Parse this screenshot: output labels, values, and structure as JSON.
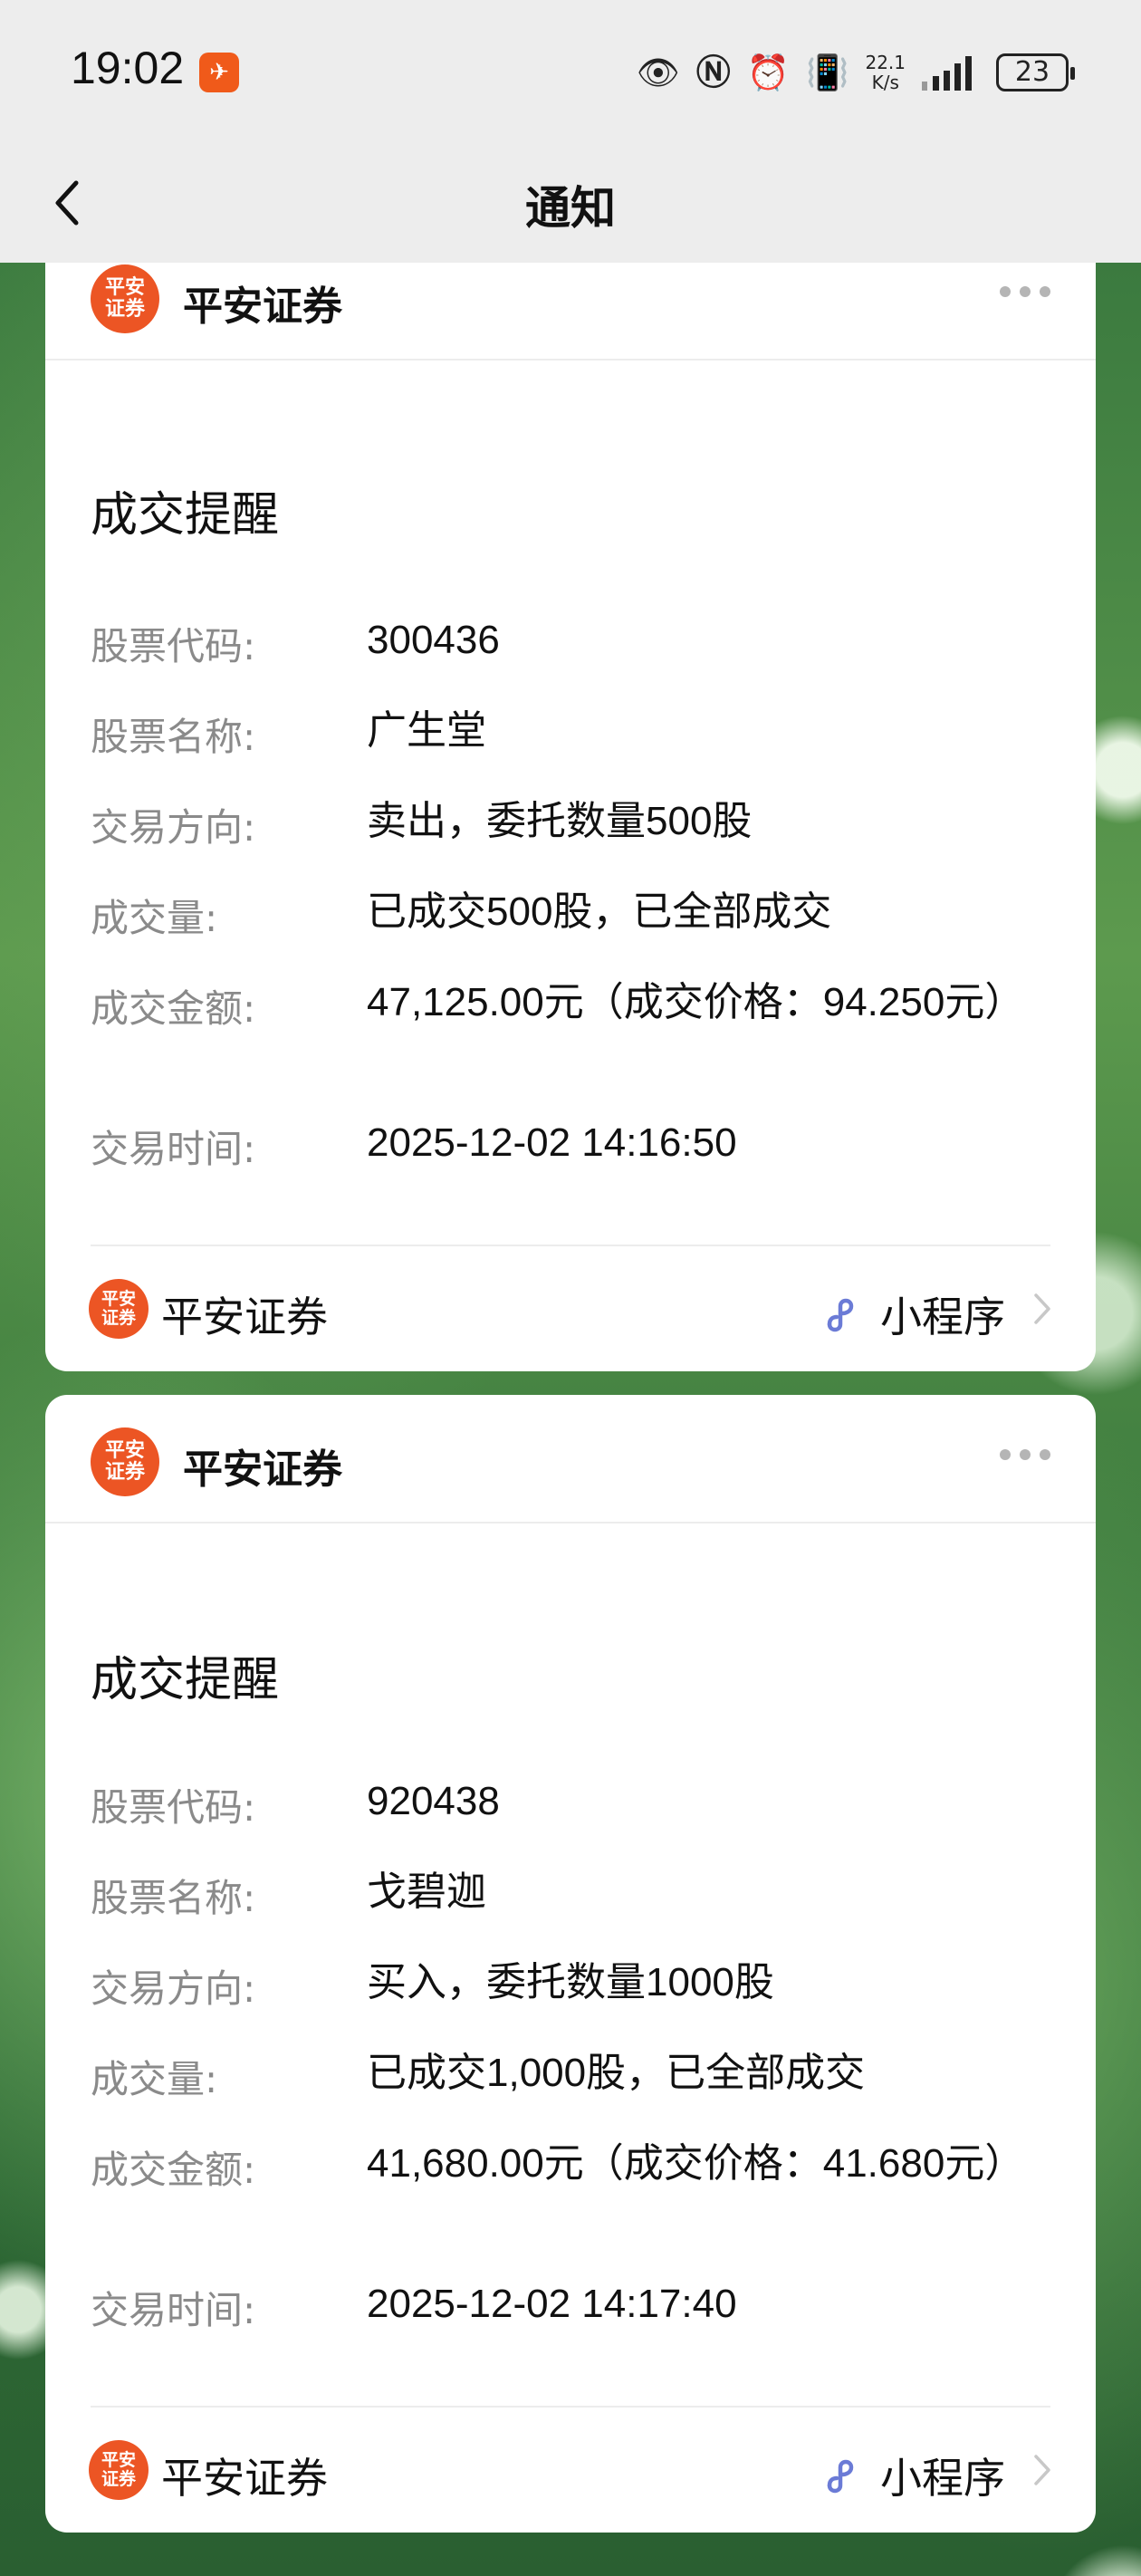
{
  "status_bar": {
    "time": "19:02",
    "app_badge_icon": "feishu-icon",
    "net_speed_value": "22.1",
    "net_speed_unit": "K/s",
    "battery": "23"
  },
  "nav": {
    "title": "通知"
  },
  "cards": [
    {
      "source": "平安证券",
      "logo_text_1": "平安",
      "logo_text_2": "证券",
      "title": "成交提醒",
      "rows": [
        {
          "label": "股票代码:",
          "value": "300436"
        },
        {
          "label": "股票名称:",
          "value": "广生堂"
        },
        {
          "label": "交易方向:",
          "value": "卖出，委托数量500股"
        },
        {
          "label": "成交量:",
          "value": "已成交500股，已全部成交"
        },
        {
          "label": "成交金额:",
          "value": "47,125.00元（成交价格：94.250元）"
        },
        {
          "label": "交易时间:",
          "value": "2025-12-02 14:16:50"
        }
      ],
      "footer_source": "平安证券",
      "mini_program_label": "小程序"
    },
    {
      "source": "平安证券",
      "logo_text_1": "平安",
      "logo_text_2": "证券",
      "title": "成交提醒",
      "rows": [
        {
          "label": "股票代码:",
          "value": "920438"
        },
        {
          "label": "股票名称:",
          "value": "戈碧迦"
        },
        {
          "label": "交易方向:",
          "value": "买入，委托数量1000股"
        },
        {
          "label": "成交量:",
          "value": "已成交1,000股，已全部成交"
        },
        {
          "label": "成交金额:",
          "value": "41,680.00元（成交价格：41.680元）"
        },
        {
          "label": "交易时间:",
          "value": "2025-12-02 14:17:40"
        }
      ],
      "footer_source": "平安证券",
      "mini_program_label": "小程序"
    }
  ],
  "colors": {
    "brand_orange": "#ec5524",
    "mini_program_blue": "#6b7bd6",
    "label_gray": "#8a8a8a"
  }
}
